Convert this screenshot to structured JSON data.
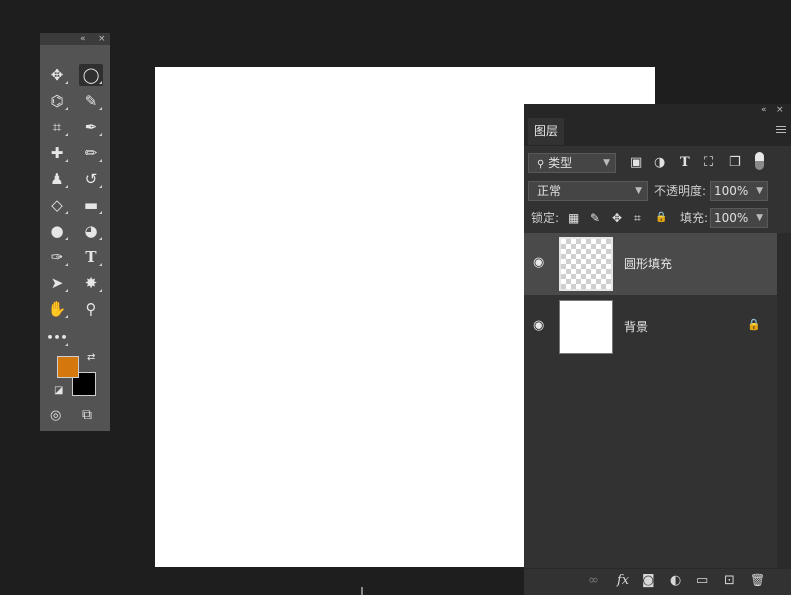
{
  "colors": {
    "foreground": "#d4770c",
    "background": "#000000",
    "canvas": "#ffffff"
  },
  "toolbar": {
    "collapse_glyph": "«",
    "close_glyph": "×",
    "tools": [
      {
        "name": "move-tool",
        "icon": "move-icon",
        "glyph": "✥"
      },
      {
        "name": "elliptical-marquee-tool",
        "icon": "ellipse-marquee-icon",
        "glyph": "◯"
      },
      {
        "name": "polygonal-lasso-tool",
        "icon": "lasso-icon",
        "glyph": "⌬"
      },
      {
        "name": "quick-selection-tool",
        "icon": "quick-selection-icon",
        "glyph": "✎"
      },
      {
        "name": "crop-tool",
        "icon": "crop-icon",
        "glyph": "⌗"
      },
      {
        "name": "eyedropper-tool",
        "icon": "eyedropper-icon",
        "glyph": "✒"
      },
      {
        "name": "spot-healing-tool",
        "icon": "bandage-icon",
        "glyph": "✚"
      },
      {
        "name": "brush-tool",
        "icon": "brush-icon",
        "glyph": "✏"
      },
      {
        "name": "clone-stamp-tool",
        "icon": "stamp-icon",
        "glyph": "♟"
      },
      {
        "name": "history-brush-tool",
        "icon": "history-brush-icon",
        "glyph": "↺"
      },
      {
        "name": "eraser-tool",
        "icon": "eraser-icon",
        "glyph": "◇"
      },
      {
        "name": "gradient-tool",
        "icon": "gradient-icon",
        "glyph": "▬"
      },
      {
        "name": "blur-tool",
        "icon": "drop-icon",
        "glyph": "●"
      },
      {
        "name": "dodge-tool",
        "icon": "dodge-icon",
        "glyph": "◕"
      },
      {
        "name": "pen-tool",
        "icon": "pen-icon",
        "glyph": "✑"
      },
      {
        "name": "type-tool",
        "icon": "type-icon",
        "glyph": "T"
      },
      {
        "name": "path-selection-tool",
        "icon": "arrow-icon",
        "glyph": "➤"
      },
      {
        "name": "custom-shape-tool",
        "icon": "shape-icon",
        "glyph": "✸"
      },
      {
        "name": "hand-tool",
        "icon": "hand-icon",
        "glyph": "✋"
      },
      {
        "name": "zoom-tool",
        "icon": "zoom-icon",
        "glyph": "⚲"
      }
    ],
    "more_glyph": "•••",
    "swap_glyph": "⇄",
    "default_glyph": "◪",
    "quickmask_glyph": "◎",
    "screenmode_glyph": "⧉"
  },
  "layers_panel": {
    "collapse_glyph": "«",
    "close_glyph": "×",
    "tab_label": "图层",
    "filter": {
      "label": "类型",
      "search_glyph": "⚲"
    },
    "filter_icons": [
      "▣",
      "◑",
      "T",
      "⛶",
      "❐"
    ],
    "blend_mode": "正常",
    "opacity_label": "不透明度:",
    "opacity_value": "100%",
    "lock_label": "锁定:",
    "lock_icons": [
      "▦",
      "✎",
      "✥",
      "⌗",
      "🔒"
    ],
    "fill_label": "填充:",
    "fill_value": "100%",
    "layers": [
      {
        "name": "圆形填充",
        "visible": true,
        "selected": true,
        "locked": false,
        "thumb": "transparent"
      },
      {
        "name": "背景",
        "visible": true,
        "selected": false,
        "locked": true,
        "thumb": "white"
      }
    ],
    "eye_glyph": "◉",
    "lock_glyph": "🔒",
    "footer_icons": [
      "∞",
      "fx",
      "◙",
      "◐",
      "▭",
      "⊡",
      "🗑"
    ]
  }
}
